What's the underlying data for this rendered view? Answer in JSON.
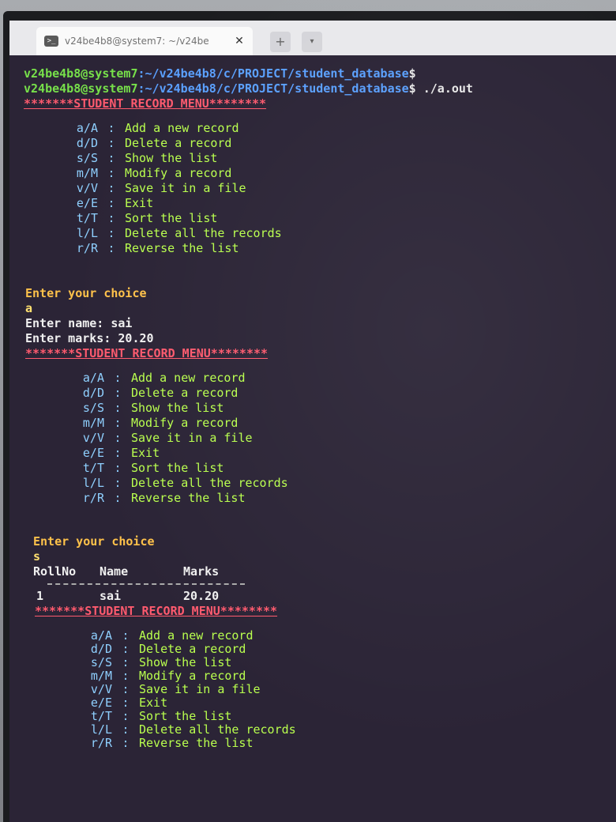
{
  "tab": {
    "title": "v24be4b8@system7: ~/v24be",
    "icon": "terminal-icon",
    "close_label": "✕",
    "new_tab_label": "+",
    "dropdown_label": "▾"
  },
  "prompts": [
    {
      "user": "v24be4b8@system7",
      "path": ":~/v24be4b8/c/PROJECT/student_database",
      "symbol": "$",
      "command": ""
    },
    {
      "user": "v24be4b8@system7",
      "path": ":~/v24be4b8/c/PROJECT/student_database",
      "symbol": "$",
      "command": " ./a.out"
    }
  ],
  "banner": "*******STUDENT RECORD MENU********",
  "menu": [
    {
      "key": "a/A",
      "label": "Add a new record"
    },
    {
      "key": "d/D",
      "label": "Delete a record"
    },
    {
      "key": "s/S",
      "label": "Show the list"
    },
    {
      "key": "m/M",
      "label": "Modify a record"
    },
    {
      "key": "v/V",
      "label": "Save it in a file"
    },
    {
      "key": "e/E",
      "label": "Exit"
    },
    {
      "key": "t/T",
      "label": "Sort the list"
    },
    {
      "key": "l/L",
      "label": "Delete all the records"
    },
    {
      "key": "r/R",
      "label": "Reverse the list"
    }
  ],
  "session1": {
    "choice_prompt": "Enter your choice",
    "choice": "a",
    "name_prompt": "Enter name: ",
    "name_value": "sai",
    "marks_prompt": "Enter marks: ",
    "marks_value": "20.20"
  },
  "session2": {
    "choice_prompt": "Enter your choice",
    "choice": "s",
    "table_header": {
      "roll": "RollNo",
      "name": "Name",
      "marks": "Marks"
    },
    "rows": [
      {
        "roll": "1",
        "name": "sai",
        "marks": "20.20"
      }
    ]
  },
  "colors": {
    "background": "#2b2436",
    "prompt_user": "#77e04a",
    "prompt_path": "#5aa0ff",
    "banner": "#ff5a6e",
    "menu_label": "#b9ff4e",
    "menu_key": "#8fd0ff",
    "choice_prompt": "#ffc24a"
  }
}
